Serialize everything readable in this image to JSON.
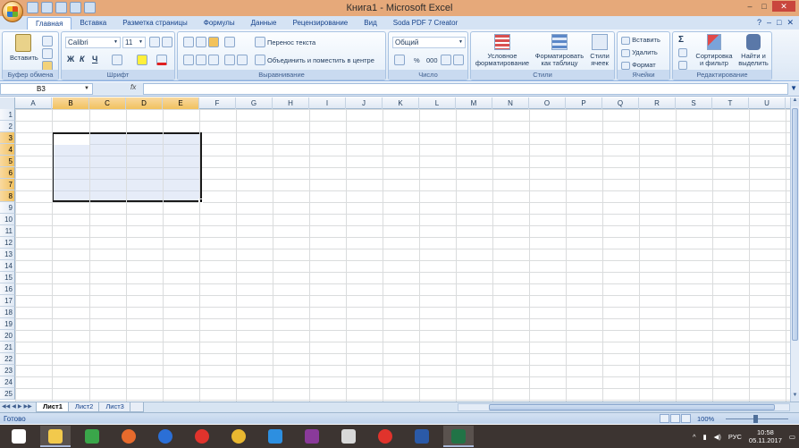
{
  "window": {
    "title": "Книга1 - Microsoft Excel",
    "min_label": "–",
    "max_label": "□",
    "close_label": "✕"
  },
  "tabs": [
    {
      "label": "Главная",
      "active": true
    },
    {
      "label": "Вставка"
    },
    {
      "label": "Разметка страницы"
    },
    {
      "label": "Формулы"
    },
    {
      "label": "Данные"
    },
    {
      "label": "Рецензирование"
    },
    {
      "label": "Вид"
    },
    {
      "label": "Soda PDF 7 Creator"
    }
  ],
  "ribbon": {
    "clipboard": {
      "paste_label": "Вставить",
      "group_label": "Буфер обмена"
    },
    "font": {
      "name": "Calibri",
      "size": "11",
      "group_label": "Шрифт",
      "bold": "Ж",
      "italic": "К",
      "underline": "Ч"
    },
    "alignment": {
      "wrap_label": "Перенос текста",
      "merge_label": "Объединить и поместить в центре",
      "group_label": "Выравнивание"
    },
    "number": {
      "format": "Общий",
      "percent": "%",
      "thousands": "000",
      "group_label": "Число"
    },
    "styles": {
      "conditional_label": "Условное форматирование",
      "table_label": "Форматировать как таблицу",
      "cell_styles_label": "Стили ячеек",
      "group_label": "Стили"
    },
    "cells": {
      "insert_label": "Вставить",
      "delete_label": "Удалить",
      "format_label": "Формат",
      "group_label": "Ячейки"
    },
    "editing": {
      "sigma": "Σ",
      "sort_label": "Сортировка и фильтр",
      "find_label": "Найти и выделить",
      "group_label": "Редактирование"
    }
  },
  "formula_bar": {
    "name_box": "B3",
    "fx": "fx",
    "value": ""
  },
  "columns": [
    "A",
    "B",
    "C",
    "D",
    "E",
    "F",
    "G",
    "H",
    "I",
    "J",
    "K",
    "L",
    "M",
    "N",
    "O",
    "P",
    "Q",
    "R",
    "S",
    "T",
    "U"
  ],
  "selected_columns": [
    "B",
    "C",
    "D",
    "E"
  ],
  "rows": [
    "1",
    "2",
    "3",
    "4",
    "5",
    "6",
    "7",
    "8",
    "9",
    "10",
    "11",
    "12",
    "13",
    "14",
    "15",
    "16",
    "17",
    "18",
    "19",
    "20",
    "21",
    "22",
    "23",
    "24",
    "25"
  ],
  "selected_rows": [
    "3",
    "4",
    "5",
    "6",
    "7",
    "8"
  ],
  "sheets": [
    {
      "label": "Лист1",
      "active": true
    },
    {
      "label": "Лист2"
    },
    {
      "label": "Лист3"
    }
  ],
  "status": {
    "text": "Готово",
    "zoom": "100%"
  },
  "taskbar": {
    "apps": [
      "start",
      "file-explorer",
      "store",
      "firefox",
      "help",
      "yandex",
      "chrome",
      "internet-explorer",
      "winrar",
      "yandex-browser",
      "yandex",
      "word",
      "excel"
    ],
    "lang": "РУС",
    "time": "10:58",
    "date": "05.11.2017"
  }
}
